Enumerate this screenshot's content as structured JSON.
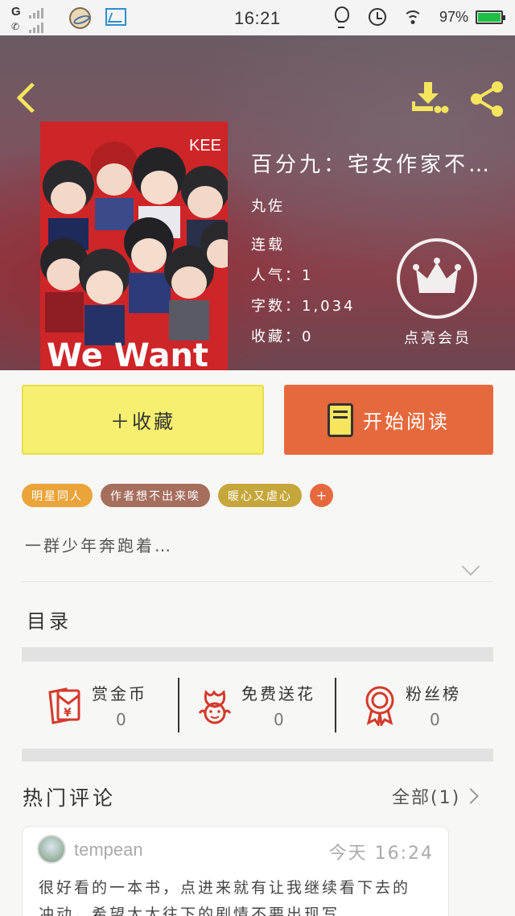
{
  "status_bar": {
    "network": "G",
    "time": "16:21",
    "battery": "97%",
    "icons": [
      "signal-icon",
      "phone-icon",
      "planet-app-icon",
      "gallery-app-icon",
      "bulb-icon",
      "alarm-icon",
      "wifi-icon",
      "battery-icon"
    ]
  },
  "book": {
    "title": "百分九：宅女作家不…",
    "author": "丸佐",
    "status": "连载",
    "popularity": "人气：1",
    "words": "字数：1,034",
    "favorites": "收藏：0",
    "cover_text": {
      "top": "KEE",
      "bottom": "We Want"
    }
  },
  "header": {
    "member_label": "点亮会员",
    "icons": [
      "back-icon",
      "download-icon",
      "share-icon",
      "crown-icon"
    ]
  },
  "actions": {
    "collect_label": "＋收藏",
    "read_label": "开始阅读"
  },
  "tags": [
    {
      "label": "明星同人",
      "color": "#eba43a"
    },
    {
      "label": "作者想不出来唉",
      "color": "#a66e5d"
    },
    {
      "label": "暖心又虐心",
      "color": "#c5a63a"
    }
  ],
  "tag_add_label": "+",
  "synopsis": "一群少年奔跑着…",
  "toc_heading": "目录",
  "stats": [
    {
      "label": "赏金币",
      "value": "0",
      "icon": "red-envelope-icon"
    },
    {
      "label": "免费送花",
      "value": "0",
      "icon": "flower-icon"
    },
    {
      "label": "粉丝榜",
      "value": "0",
      "icon": "medal-icon"
    }
  ],
  "comments": {
    "heading": "热门评论",
    "all_label": "全部(1)",
    "items": [
      {
        "username": "tempean",
        "time": "今天 16:24",
        "text": "很好看的一本书，点进来就有让我继续看下去的冲动，希望太太往下的剧情不要出现写"
      }
    ]
  },
  "colors": {
    "accent_yellow": "#f6ef6f",
    "accent_orange": "#e6693d",
    "icon_red": "#d33a2c",
    "header_icon_yellow": "#f4e55d"
  }
}
